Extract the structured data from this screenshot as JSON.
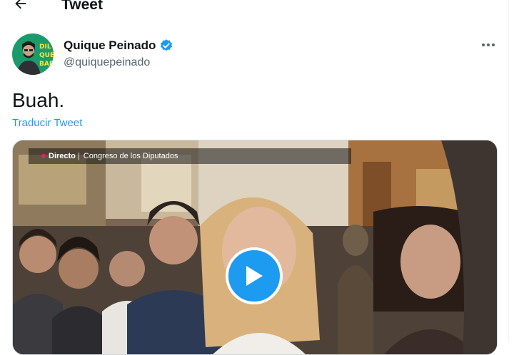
{
  "header": {
    "title": "Tweet",
    "back_icon": "arrow-left-icon"
  },
  "tweet": {
    "author": {
      "name": "Quique Peinado",
      "handle": "@quiquepeinado",
      "verified": true,
      "avatar_text_lines": [
        "DIL",
        "QUE",
        "BAR"
      ]
    },
    "text": "Buah.",
    "translate_label": "Traducir Tweet",
    "media": {
      "type": "video",
      "live_label": "Directo",
      "separator": "|",
      "channel": "Congreso de los Diputados"
    }
  },
  "colors": {
    "accent": "#1d9bf0",
    "text_secondary": "#536471",
    "avatar_bg": "#1a9b6c"
  },
  "icons": [
    "arrow-left-icon",
    "verified-badge-icon",
    "more-options-icon",
    "play-icon"
  ]
}
